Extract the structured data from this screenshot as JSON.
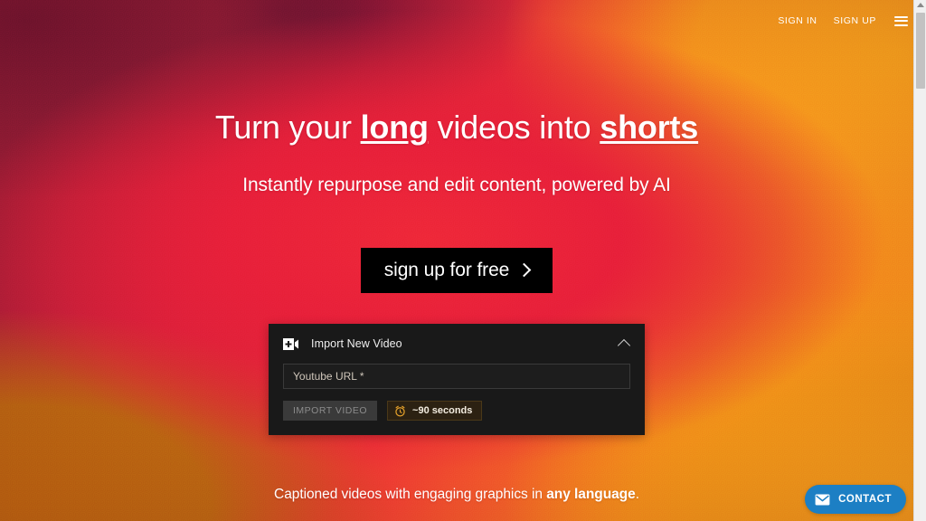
{
  "nav": {
    "sign_in": "SIGN IN",
    "sign_up": "SIGN UP",
    "menu_icon": "hamburger-menu-icon"
  },
  "hero": {
    "headline": {
      "part1": "Turn your ",
      "emphasis1": "long",
      "part2": " videos into ",
      "emphasis2": "shorts"
    },
    "subheadline": "Instantly repurpose and edit content, powered by AI",
    "cta_label": "sign up for free",
    "cta_icon": "chevron-right-icon"
  },
  "import_card": {
    "icon": "video-plus-icon",
    "title": "Import New Video",
    "collapse_icon": "chevron-up-icon",
    "url_placeholder": "Youtube URL *",
    "url_value": "",
    "import_button_label": "IMPORT VIDEO",
    "time_badge": {
      "icon": "alarm-clock-icon",
      "label": "~90 seconds"
    }
  },
  "footer": {
    "text_part1": "Captioned videos with engaging graphics in ",
    "text_bold": "any language",
    "text_part2": "."
  },
  "contact_widget": {
    "label": "CONTACT",
    "icon": "envelope-icon",
    "color": "#1c7fc4"
  },
  "colors": {
    "hero_red": "#e8203a",
    "orange": "#f5941d",
    "deep_maroon": "#7a1530",
    "amber": "#c2680f",
    "card_bg": "#191919",
    "cta_black": "#000000",
    "badge_orange": "#e8a22a"
  },
  "scrollbar": {
    "up_arrow_icon": "scroll-up-arrow-icon",
    "thumb": "scrollbar-thumb"
  }
}
